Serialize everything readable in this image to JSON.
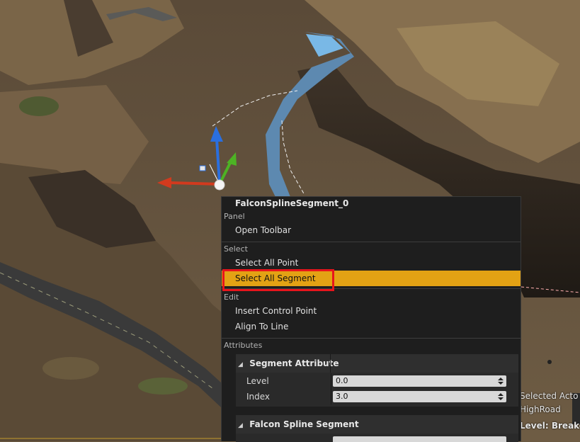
{
  "menu": {
    "title": "FalconSplineSegment_0",
    "sections": {
      "panel": "Panel",
      "select": "Select",
      "edit": "Edit",
      "attributes": "Attributes"
    },
    "items": {
      "open_toolbar": "Open Toolbar",
      "select_all_point": "Select All Point",
      "select_all_segment": "Select All Segment",
      "insert_control_point": "Insert Control Point",
      "align_to_line": "Align To Line"
    },
    "highlighted_item": "Select All Segment"
  },
  "attributes": {
    "segment_attribute": {
      "header": "Segment Attribute",
      "level_label": "Level",
      "level_value": "0.0",
      "index_label": "Index",
      "index_value": "3.0"
    },
    "falcon_spline_segment": {
      "header": "Falcon Spline Segment"
    }
  },
  "viewport_overlay": {
    "selected_actor": "Selected Acto",
    "actor_name": "HighRoad",
    "level_label": "Level:",
    "level_value": "Breako"
  },
  "colors": {
    "highlight": "#e3a214",
    "annotation_box": "#e8141c",
    "menu_background": "#1e1e1e",
    "gizmo_x": "#d23a1e",
    "gizmo_y": "#4db324",
    "gizmo_z": "#2a6fe0"
  }
}
